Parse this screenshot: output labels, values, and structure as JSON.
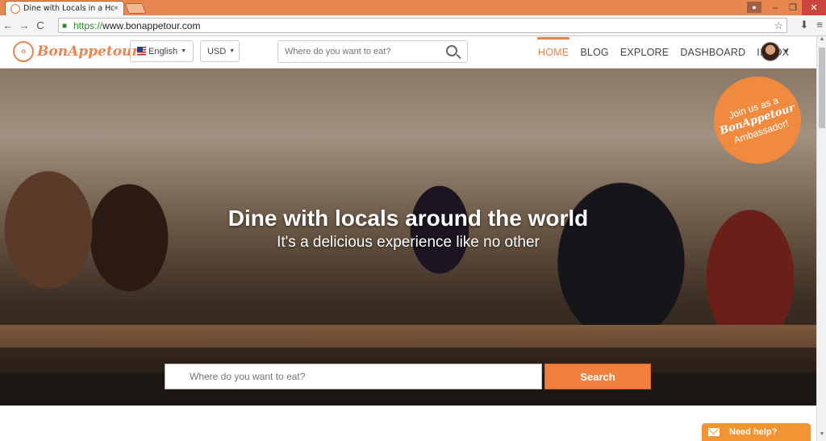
{
  "browser": {
    "tab_title": "Dine with Locals in a Hom",
    "tab_close": "×",
    "url_scheme": "https://",
    "url_rest": "www.bonappetour.com",
    "back_icon": "←",
    "forward_icon": "→",
    "reload_icon": "C",
    "star_icon": "☆",
    "menu_icon": "≡",
    "win_min": "–",
    "win_max": "❐",
    "win_close": "✕"
  },
  "site": {
    "logo_text": "BonAppetour",
    "language_label": "English",
    "currency_label": "USD",
    "search_placeholder": "Where do you want to eat?",
    "nav": [
      "HOME",
      "BLOG",
      "EXPLORE",
      "DASHBOARD",
      "INBOX"
    ],
    "active_nav": "HOME"
  },
  "hero": {
    "title": "Dine with locals around the world",
    "subtitle": "It's a delicious experience like no other",
    "badge_line1": "Join us as a",
    "badge_brand": "BonAppetour",
    "badge_line3": "Ambassador!",
    "search_placeholder": "Where do you want to eat?",
    "search_button": "Search"
  },
  "help": {
    "label": "Need help?"
  },
  "colors": {
    "accent": "#e8864f",
    "button": "#f07f3c"
  }
}
